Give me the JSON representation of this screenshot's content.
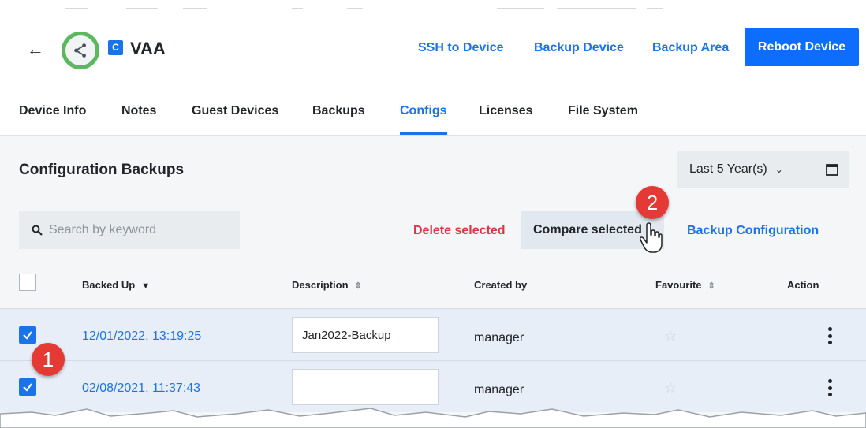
{
  "header": {
    "device_badge": "C",
    "device_name": "VAA",
    "links": {
      "ssh": "SSH to Device",
      "backup_device": "Backup Device",
      "backup_area": "Backup Area"
    },
    "reboot_label": "Reboot Device"
  },
  "tabs": [
    {
      "label": "Device Info"
    },
    {
      "label": "Notes"
    },
    {
      "label": "Guest Devices"
    },
    {
      "label": "Backups"
    },
    {
      "label": "Configs",
      "active": true
    },
    {
      "label": "Licenses"
    },
    {
      "label": "File System"
    }
  ],
  "panel": {
    "title": "Configuration Backups",
    "range_label": "Last 5 Year(s)",
    "search_placeholder": "Search by keyword",
    "delete_selected": "Delete selected",
    "compare_selected": "Compare selected",
    "backup_configuration": "Backup Configuration"
  },
  "table": {
    "headers": {
      "backed_up": "Backed Up",
      "description": "Description",
      "created_by": "Created by",
      "favourite": "Favourite",
      "action": "Action"
    },
    "rows": [
      {
        "date": "12/01/2022, 13:19:25",
        "description": "Jan2022-Backup",
        "created_by": "manager",
        "checked": true
      },
      {
        "date": "02/08/2021, 11:37:43",
        "description": "",
        "created_by": "manager",
        "checked": true
      }
    ]
  },
  "markers": {
    "one": "1",
    "two": "2"
  },
  "colors": {
    "accent": "#1a73e8",
    "primary_button": "#0d6efd",
    "danger": "#dc3545",
    "share_ring": "#5cb85c",
    "marker": "#e53935",
    "selected_row": "#e8eef7"
  },
  "icons": {
    "back": "arrow-left-icon",
    "share": "share-icon",
    "range": "chevron-down-icon",
    "calendar": "calendar-icon",
    "search": "search-icon",
    "sort": "sort-icon",
    "favourite": "star-icon",
    "action": "kebab-menu-icon",
    "cursor": "hand-pointer-icon"
  }
}
